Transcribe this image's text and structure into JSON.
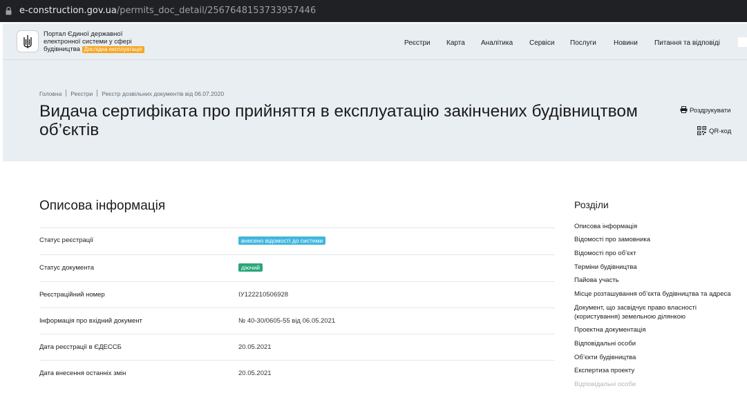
{
  "browser": {
    "url_domain": "e-construction.gov.ua",
    "url_path": "/permits_doc_detail/2567648153733957446"
  },
  "header": {
    "portal_title": "Портал Єдиної державної електронної системи у сфері будівництва",
    "test_badge": "Дослідна експлуатація",
    "nav": [
      "Реєстри",
      "Карта",
      "Аналітика",
      "Сервіси",
      "Послуги",
      "Новини",
      "Питання та відповіді"
    ]
  },
  "breadcrumbs": [
    "Головна",
    "Реєстри",
    "Реєстр дозвільних документів від 06.07.2020"
  ],
  "page": {
    "title": "Видача сертифіката про прийняття в експлуатацію закінчених будівництвом об’єктів",
    "print_label": "Роздрукувати",
    "qr_label": "QR-код"
  },
  "info": {
    "heading": "Описова інформація",
    "rows": [
      {
        "label": "Статус реєстрації",
        "value": "внесено відомості до системи",
        "chip_color": "#3fb7dd"
      },
      {
        "label": "Статус документа",
        "value": "діючий",
        "chip_color": "#2aa67a"
      },
      {
        "label": "Реєстраційний номер",
        "value": "ІУ122210506928"
      },
      {
        "label": "Інформація про вхідний документ",
        "value": "№ 40-30/0605-55 від 06.05.2021"
      },
      {
        "label": "Дата реєстрації в ЄДЕССБ",
        "value": "20.05.2021"
      },
      {
        "label": "Дата внесення останніх змін",
        "value": "20.05.2021"
      }
    ]
  },
  "sections": {
    "heading": "Розділи",
    "items": [
      "Описова інформація",
      "Відомості про замовника",
      "Відомості про об’єкт",
      "Терміни будівництва",
      "Пайова участь",
      "Місце розташування об’єкта будівництва та адреса",
      "Документ, що засвідчує право власності (користування) земельною ділянкою",
      "Проектна документація",
      "Відповідальні особи",
      "Об’єкти будівництва",
      "Експертиза проекту",
      "Відповідальні особи"
    ]
  }
}
